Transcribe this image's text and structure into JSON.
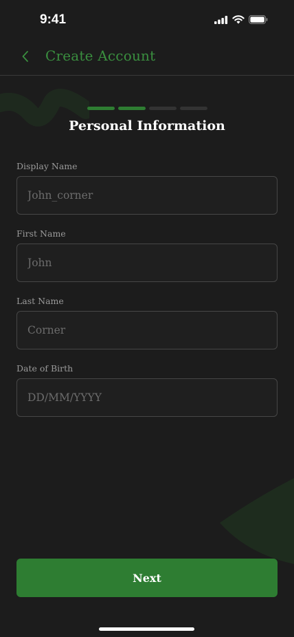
{
  "status_bar": {
    "time": "9:41",
    "icons": [
      "cellular-signal-icon",
      "wifi-icon",
      "battery-icon"
    ]
  },
  "nav": {
    "back_icon": "chevron-left-icon",
    "title": "Create Account"
  },
  "progress": {
    "total_steps": 4,
    "completed_steps": 2,
    "active_color": "#2e7d32",
    "inactive_color": "#333333"
  },
  "page_title": "Personal Information",
  "form": {
    "display_name": {
      "label": "Display Name",
      "value": "",
      "placeholder": "John_corner"
    },
    "first_name": {
      "label": "First Name",
      "value": "",
      "placeholder": "John"
    },
    "last_name": {
      "label": "Last Name",
      "value": "",
      "placeholder": "Corner"
    },
    "date_of_birth": {
      "label": "Date of Birth",
      "value": "",
      "placeholder": "DD/MM/YYYY"
    }
  },
  "next_button": {
    "label": "Next"
  },
  "colors": {
    "accent": "#2e7d32",
    "accent_text": "#3a8f3f",
    "background": "#1c1c1c"
  }
}
